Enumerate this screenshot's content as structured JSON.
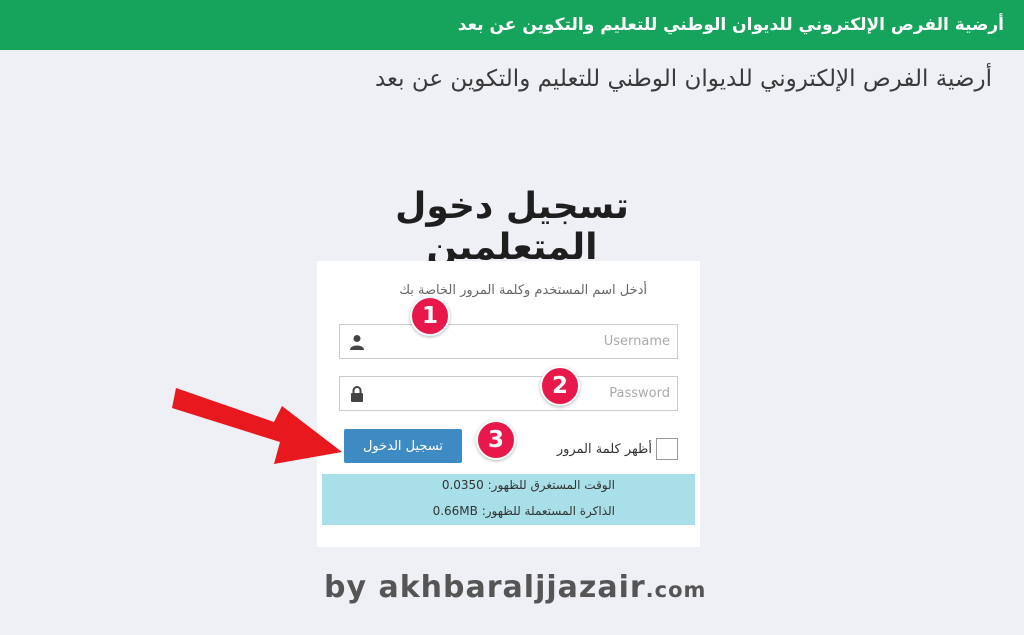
{
  "header": {
    "title": "أرضية الفرص الإلكتروني للديوان الوطني للتعليم والتكوين عن بعد"
  },
  "page": {
    "platform_title": "أرضية الفرص الإلكتروني للديوان الوطني للتعليم والتكوين عن بعد",
    "heading": "تسجيل دخول المتعلمين"
  },
  "login_form": {
    "instructions": "أدخل اسم المستخدم وكلمة المرور الخاصة بك",
    "username": {
      "value": "",
      "placeholder": "Username",
      "icon": "user-icon"
    },
    "password": {
      "value": "",
      "placeholder": "Password",
      "icon": "lock-icon"
    },
    "show_password_label": "أظهر كلمة المرور",
    "show_password_checked": false,
    "submit_label": "تسجيل الدخول"
  },
  "stats": {
    "render_time": "الوقت المستغرق للظهور: 0.0350",
    "memory": "الذاكرة المستعملة للظهور: 0.66MB"
  },
  "annotations": {
    "steps": [
      "1",
      "2",
      "3"
    ],
    "arrow_color": "#e8191e",
    "badge_color": "#e8194a"
  },
  "watermark": {
    "by": "by",
    "site": "akhbaraljjazair",
    "tld": ".com"
  },
  "colors": {
    "header_bg": "#16a35b",
    "button_bg": "#3e8ac2",
    "stats_bg": "#a8dfe8",
    "page_bg": "#eef0f6"
  }
}
